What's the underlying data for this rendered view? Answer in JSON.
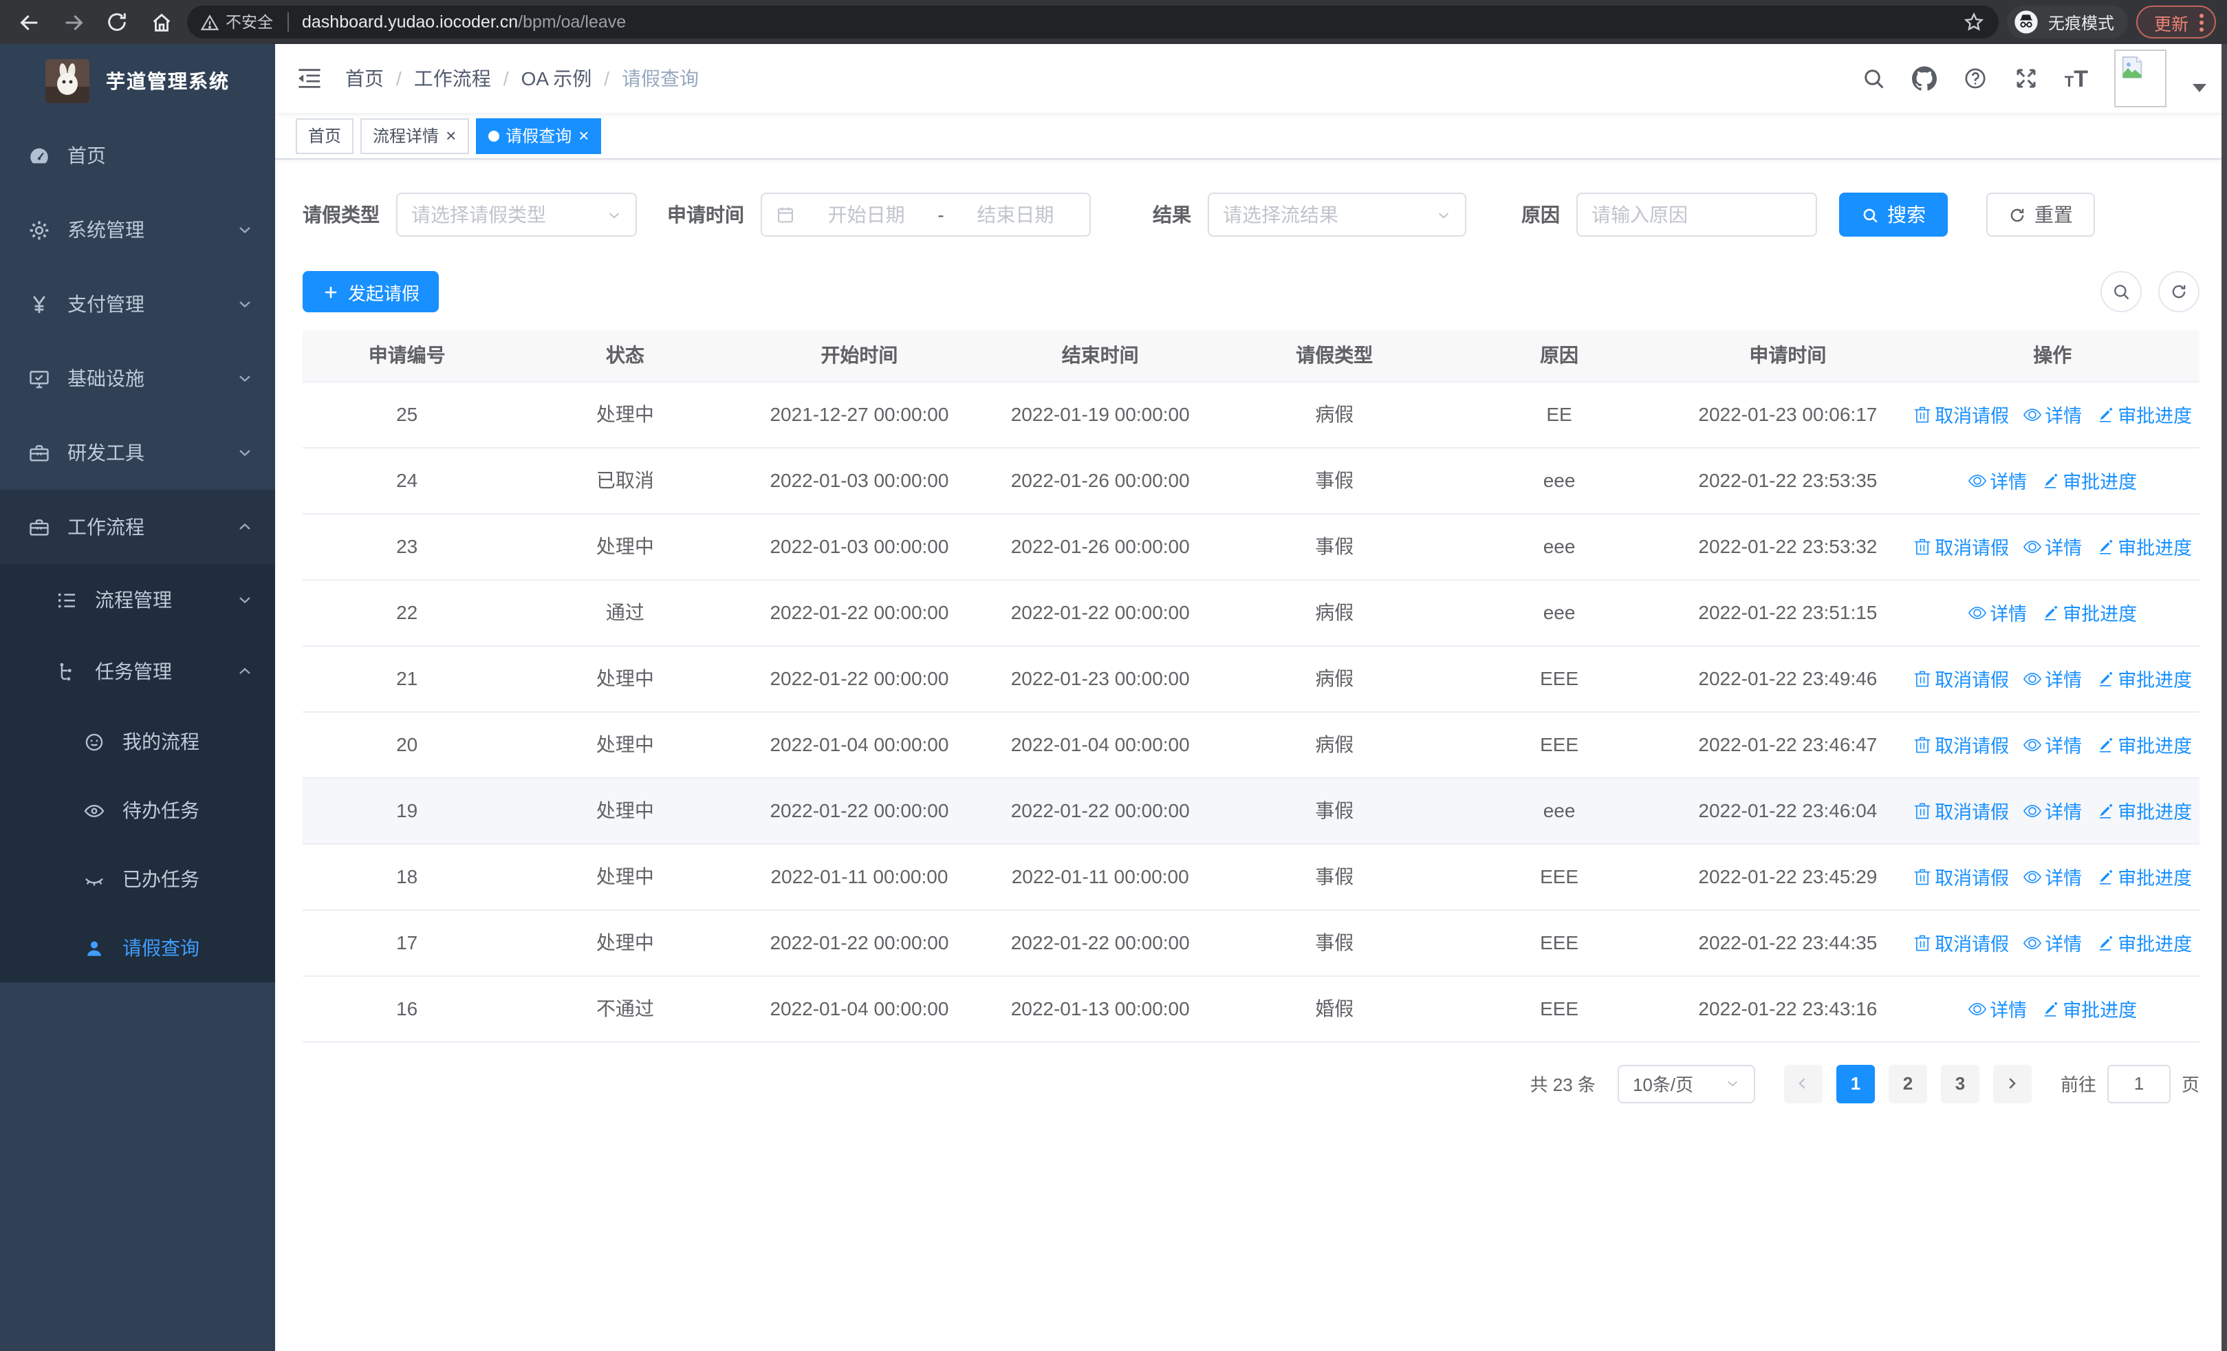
{
  "colors": {
    "accent": "#1890ff",
    "sidebar_bg": "#304156",
    "sidebar_submenu_bg": "#1f2d3d",
    "sidebar_section_bg": "#263445",
    "sidebar_text": "#bfcbd9",
    "sidebar_active_text": "#409eff"
  },
  "browser": {
    "security_label": "不安全",
    "url_host": "dashboard.yudao.iocoder.cn",
    "url_path": "/bpm/oa/leave",
    "incognito_label": "无痕模式",
    "update_label": "更新"
  },
  "icons": {
    "close": "×",
    "breadcrumb_separator": "/",
    "yen": "¥"
  },
  "app": {
    "title": "芋道管理系统"
  },
  "sidebar": {
    "items": [
      {
        "label": "首页"
      },
      {
        "label": "系统管理"
      },
      {
        "label": "支付管理"
      },
      {
        "label": "基础设施"
      },
      {
        "label": "研发工具"
      },
      {
        "label": "工作流程"
      },
      {
        "label": "流程管理"
      },
      {
        "label": "任务管理"
      },
      {
        "label": "我的流程"
      },
      {
        "label": "待办任务"
      },
      {
        "label": "已办任务"
      },
      {
        "label": "请假查询"
      }
    ]
  },
  "breadcrumb": {
    "items": [
      "首页",
      "工作流程",
      "OA 示例",
      "请假查询"
    ]
  },
  "tabs": [
    {
      "label": "首页"
    },
    {
      "label": "流程详情"
    },
    {
      "label": "请假查询"
    }
  ],
  "filters": {
    "type_label": "请假类型",
    "type_placeholder": "请选择请假类型",
    "time_label": "申请时间",
    "start_placeholder": "开始日期",
    "separator": "-",
    "end_placeholder": "结束日期",
    "result_label": "结果",
    "result_placeholder": "请选择流结果",
    "reason_label": "原因",
    "reason_placeholder": "请输入原因",
    "search_label": "搜索",
    "reset_label": "重置"
  },
  "toolbar": {
    "create_label": "发起请假"
  },
  "table": {
    "headers": [
      "申请编号",
      "状态",
      "开始时间",
      "结束时间",
      "请假类型",
      "原因",
      "申请时间",
      "操作"
    ],
    "action_labels": {
      "cancel": "取消请假",
      "detail": "详情",
      "progress": "审批进度"
    },
    "rows": [
      {
        "id": "25",
        "status": "处理中",
        "start": "2021-12-27 00:00:00",
        "end": "2022-01-19 00:00:00",
        "type": "病假",
        "reason": "EE",
        "applyTime": "2022-01-23 00:06:17",
        "actions": [
          {
            "label": "取消请假",
            "icon": "icon-delete",
            "name": "cancel-leave-link"
          },
          {
            "label": "详情",
            "icon": "icon-view",
            "name": "detail-link"
          },
          {
            "label": "审批进度",
            "icon": "icon-edit",
            "name": "approval-progress-link"
          }
        ]
      },
      {
        "id": "24",
        "status": "已取消",
        "start": "2022-01-03 00:00:00",
        "end": "2022-01-26 00:00:00",
        "type": "事假",
        "reason": "eee",
        "applyTime": "2022-01-22 23:53:35",
        "actions": [
          {
            "label": "详情",
            "icon": "icon-view",
            "name": "detail-link"
          },
          {
            "label": "审批进度",
            "icon": "icon-edit",
            "name": "approval-progress-link"
          }
        ]
      },
      {
        "id": "23",
        "status": "处理中",
        "start": "2022-01-03 00:00:00",
        "end": "2022-01-26 00:00:00",
        "type": "事假",
        "reason": "eee",
        "applyTime": "2022-01-22 23:53:32",
        "actions": [
          {
            "label": "取消请假",
            "icon": "icon-delete",
            "name": "cancel-leave-link"
          },
          {
            "label": "详情",
            "icon": "icon-view",
            "name": "detail-link"
          },
          {
            "label": "审批进度",
            "icon": "icon-edit",
            "name": "approval-progress-link"
          }
        ]
      },
      {
        "id": "22",
        "status": "通过",
        "start": "2022-01-22 00:00:00",
        "end": "2022-01-22 00:00:00",
        "type": "病假",
        "reason": "eee",
        "applyTime": "2022-01-22 23:51:15",
        "actions": [
          {
            "label": "详情",
            "icon": "icon-view",
            "name": "detail-link"
          },
          {
            "label": "审批进度",
            "icon": "icon-edit",
            "name": "approval-progress-link"
          }
        ]
      },
      {
        "id": "21",
        "status": "处理中",
        "start": "2022-01-22 00:00:00",
        "end": "2022-01-23 00:00:00",
        "type": "病假",
        "reason": "EEE",
        "applyTime": "2022-01-22 23:49:46",
        "actions": [
          {
            "label": "取消请假",
            "icon": "icon-delete",
            "name": "cancel-leave-link"
          },
          {
            "label": "详情",
            "icon": "icon-view",
            "name": "detail-link"
          },
          {
            "label": "审批进度",
            "icon": "icon-edit",
            "name": "approval-progress-link"
          }
        ]
      },
      {
        "id": "20",
        "status": "处理中",
        "start": "2022-01-04 00:00:00",
        "end": "2022-01-04 00:00:00",
        "type": "病假",
        "reason": "EEE",
        "applyTime": "2022-01-22 23:46:47",
        "actions": [
          {
            "label": "取消请假",
            "icon": "icon-delete",
            "name": "cancel-leave-link"
          },
          {
            "label": "详情",
            "icon": "icon-view",
            "name": "detail-link"
          },
          {
            "label": "审批进度",
            "icon": "icon-edit",
            "name": "approval-progress-link"
          }
        ]
      },
      {
        "id": "19",
        "status": "处理中",
        "start": "2022-01-22 00:00:00",
        "end": "2022-01-22 00:00:00",
        "type": "事假",
        "reason": "eee",
        "applyTime": "2022-01-22 23:46:04",
        "highlight": true,
        "actions": [
          {
            "label": "取消请假",
            "icon": "icon-delete",
            "name": "cancel-leave-link"
          },
          {
            "label": "详情",
            "icon": "icon-view",
            "name": "detail-link"
          },
          {
            "label": "审批进度",
            "icon": "icon-edit",
            "name": "approval-progress-link"
          }
        ]
      },
      {
        "id": "18",
        "status": "处理中",
        "start": "2022-01-11 00:00:00",
        "end": "2022-01-11 00:00:00",
        "type": "事假",
        "reason": "EEE",
        "applyTime": "2022-01-22 23:45:29",
        "actions": [
          {
            "label": "取消请假",
            "icon": "icon-delete",
            "name": "cancel-leave-link"
          },
          {
            "label": "详情",
            "icon": "icon-view",
            "name": "detail-link"
          },
          {
            "label": "审批进度",
            "icon": "icon-edit",
            "name": "approval-progress-link"
          }
        ]
      },
      {
        "id": "17",
        "status": "处理中",
        "start": "2022-01-22 00:00:00",
        "end": "2022-01-22 00:00:00",
        "type": "事假",
        "reason": "EEE",
        "applyTime": "2022-01-22 23:44:35",
        "actions": [
          {
            "label": "取消请假",
            "icon": "icon-delete",
            "name": "cancel-leave-link"
          },
          {
            "label": "详情",
            "icon": "icon-view",
            "name": "detail-link"
          },
          {
            "label": "审批进度",
            "icon": "icon-edit",
            "name": "approval-progress-link"
          }
        ]
      },
      {
        "id": "16",
        "status": "不通过",
        "start": "2022-01-04 00:00:00",
        "end": "2022-01-13 00:00:00",
        "type": "婚假",
        "reason": "EEE",
        "applyTime": "2022-01-22 23:43:16",
        "actions": [
          {
            "label": "详情",
            "icon": "icon-view",
            "name": "detail-link"
          },
          {
            "label": "审批进度",
            "icon": "icon-edit",
            "name": "approval-progress-link"
          }
        ]
      }
    ]
  },
  "pagination": {
    "total_label": "共 23 条",
    "page_size": "10条/页",
    "pages": [
      "1",
      "2",
      "3"
    ],
    "current": "1",
    "goto_label": "前往",
    "goto_value": "1",
    "unit_label": "页"
  }
}
